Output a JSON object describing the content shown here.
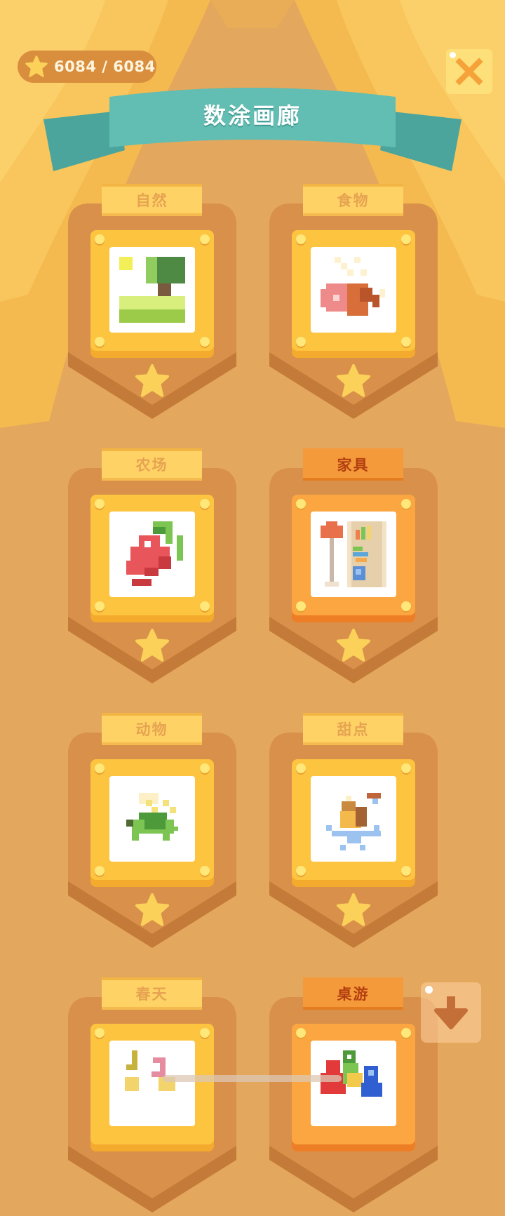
{
  "header": {
    "score_text": "6084 / 6084",
    "title": "数涂画廊"
  },
  "categories": [
    {
      "label": "自然",
      "completed": false
    },
    {
      "label": "食物",
      "completed": false
    },
    {
      "label": "农场",
      "completed": false
    },
    {
      "label": "家具",
      "completed": true
    },
    {
      "label": "动物",
      "completed": false
    },
    {
      "label": "甜点",
      "completed": false
    },
    {
      "label": "春天",
      "completed": false
    },
    {
      "label": "桌游",
      "completed": true
    }
  ],
  "icons": {
    "score": "star-icon",
    "close": "close-icon",
    "download": "arrow-down-icon"
  },
  "colors": {
    "background": "#e3a75e",
    "ribbon": "#62bdb2",
    "frame": "#fdc440",
    "completed_tag": "#f59a3a",
    "close_button": "#fde07a"
  }
}
